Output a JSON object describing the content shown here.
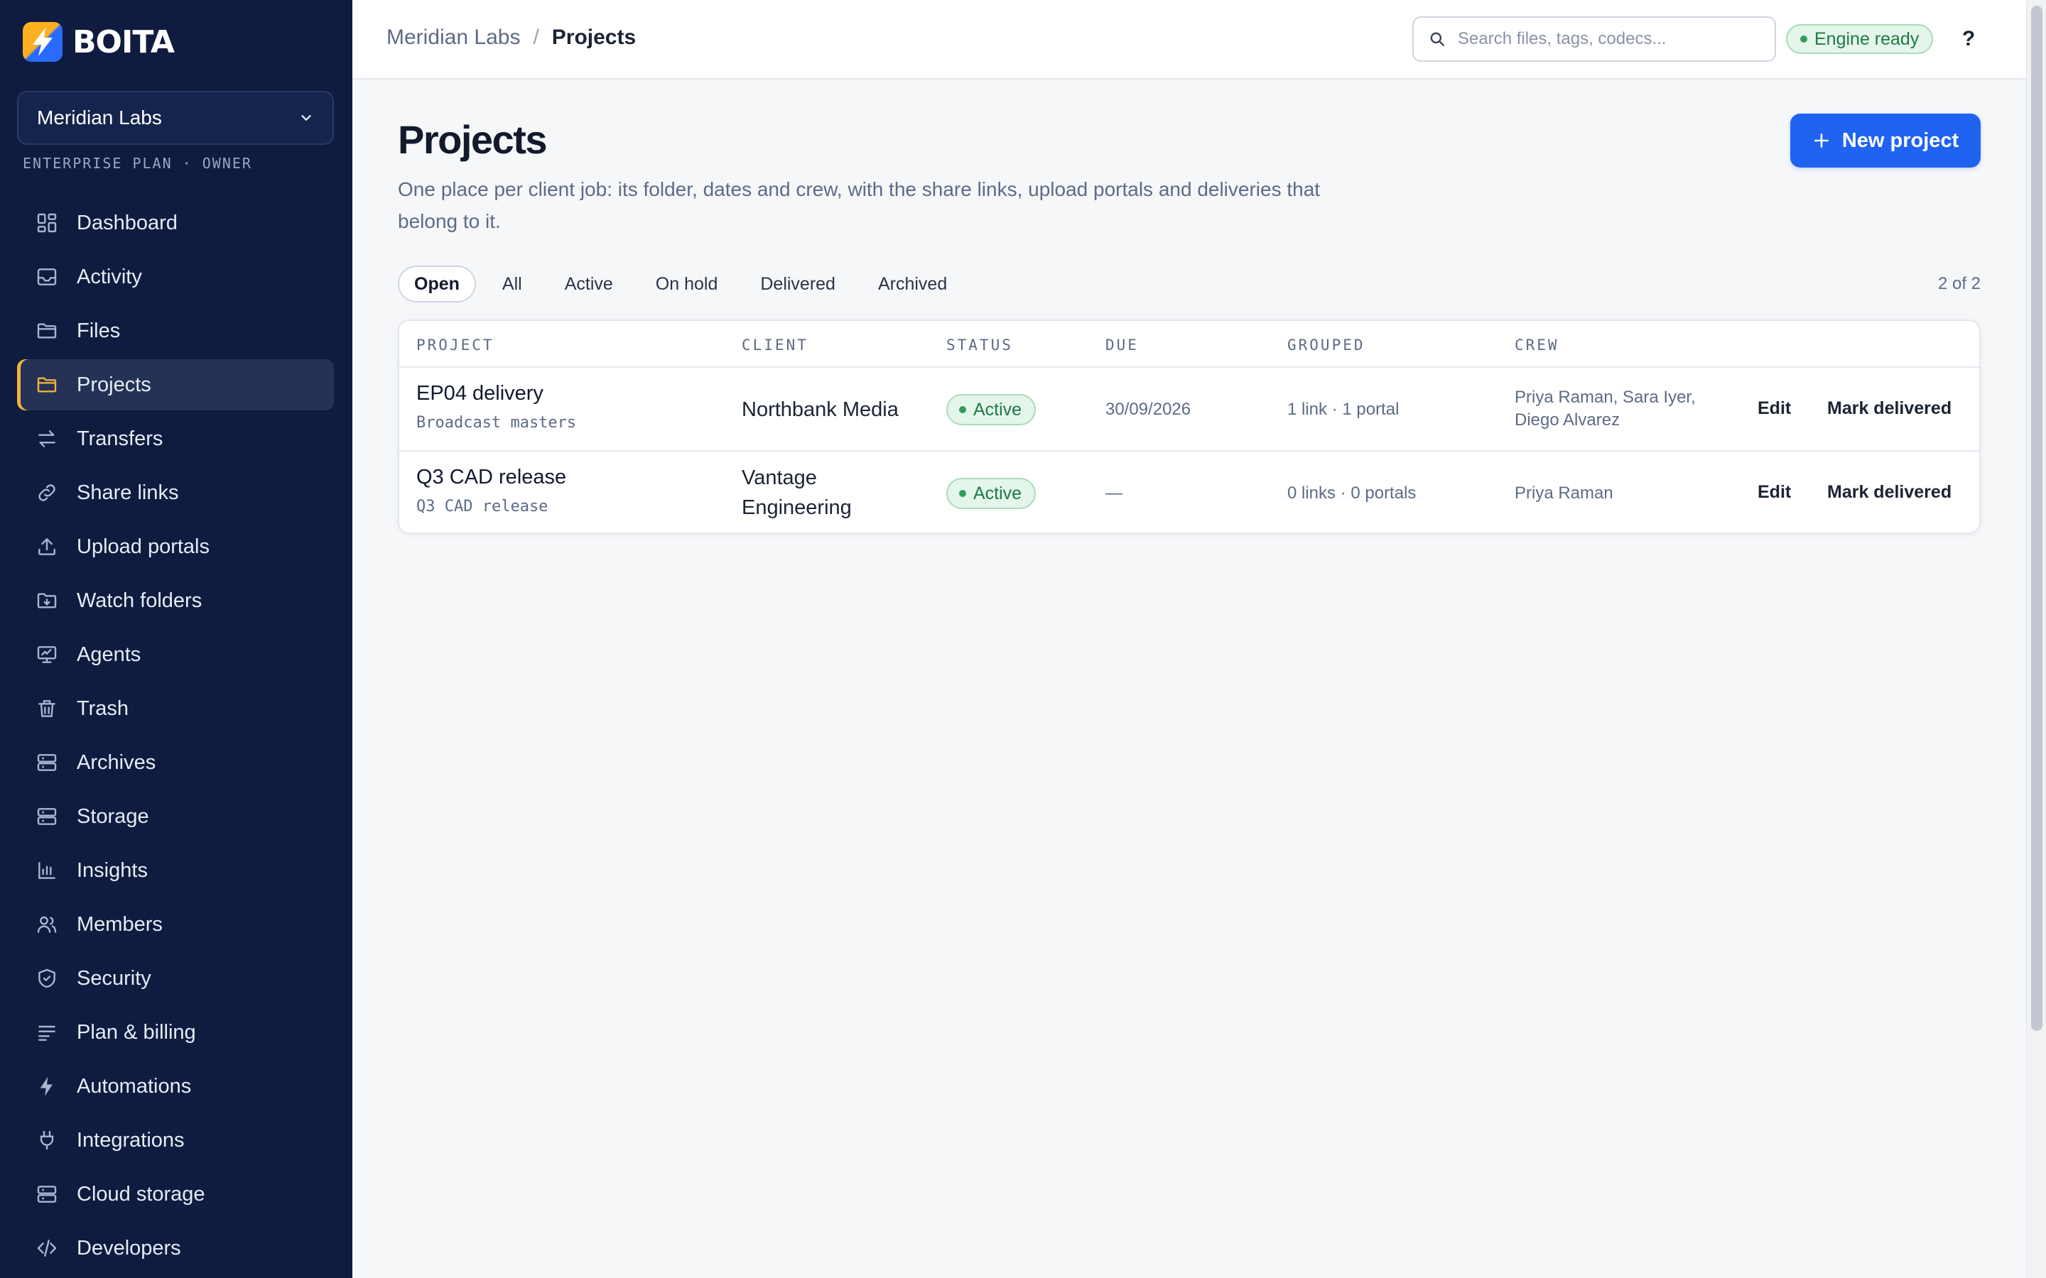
{
  "brand": {
    "name": "BOITA"
  },
  "org": {
    "name": "Meridian Labs",
    "plan": "ENTERPRISE PLAN · OWNER"
  },
  "nav": [
    {
      "label": "Dashboard",
      "icon": "dashboard-icon"
    },
    {
      "label": "Activity",
      "icon": "inbox-icon"
    },
    {
      "label": "Files",
      "icon": "folder-icon"
    },
    {
      "label": "Projects",
      "icon": "folder-icon",
      "active": true
    },
    {
      "label": "Transfers",
      "icon": "transfer-icon"
    },
    {
      "label": "Share links",
      "icon": "link-icon"
    },
    {
      "label": "Upload portals",
      "icon": "upload-icon"
    },
    {
      "label": "Watch folders",
      "icon": "watch-folder-icon"
    },
    {
      "label": "Agents",
      "icon": "monitor-icon"
    },
    {
      "label": "Trash",
      "icon": "trash-icon"
    },
    {
      "label": "Archives",
      "icon": "server-icon"
    },
    {
      "label": "Storage",
      "icon": "server-icon"
    },
    {
      "label": "Insights",
      "icon": "bar-chart-icon"
    },
    {
      "label": "Members",
      "icon": "users-icon"
    },
    {
      "label": "Security",
      "icon": "shield-icon"
    },
    {
      "label": "Plan & billing",
      "icon": "list-icon"
    },
    {
      "label": "Automations",
      "icon": "bolt-icon"
    },
    {
      "label": "Integrations",
      "icon": "plug-icon"
    },
    {
      "label": "Cloud storage",
      "icon": "server-icon"
    },
    {
      "label": "Developers",
      "icon": "code-icon"
    }
  ],
  "topbar": {
    "breadcrumb": [
      "Meridian Labs",
      "/",
      "Projects"
    ],
    "search_placeholder": "Search files, tags, codecs...",
    "engine_status": "Engine ready",
    "help_label": "?"
  },
  "main": {
    "title": "Projects",
    "description": "One place per client job: its folder, dates and crew, with the share links, upload portals and deliveries that belong to it.",
    "new_button": "New project",
    "filters": [
      {
        "label": "Open",
        "active": true
      },
      {
        "label": "All"
      },
      {
        "label": "Active"
      },
      {
        "label": "On hold"
      },
      {
        "label": "Delivered"
      },
      {
        "label": "Archived"
      }
    ],
    "count": "2 of 2",
    "columns": [
      "PROJECT",
      "CLIENT",
      "STATUS",
      "DUE",
      "GROUPED",
      "CREW"
    ],
    "rows": [
      {
        "name": "EP04 delivery",
        "subtitle": "Broadcast masters",
        "client": "Northbank Media",
        "status": "Active",
        "due": "30/09/2026",
        "grouped": "1 link · 1 portal",
        "crew": "Priya Raman, Sara Iyer, Diego Alvarez",
        "edit": "Edit",
        "mark": "Mark delivered"
      },
      {
        "name": "Q3 CAD release",
        "subtitle": "Q3 CAD release",
        "client": "Vantage Engineering",
        "status": "Active",
        "due": "—",
        "grouped": "0 links · 0 portals",
        "crew": "Priya Raman",
        "edit": "Edit",
        "mark": "Mark delivered"
      }
    ]
  },
  "colors": {
    "sidebar": "#0f1c3f",
    "accent": "#1f63f0",
    "active_indicator": "#f2b33d",
    "success": "#2f9e5b"
  }
}
